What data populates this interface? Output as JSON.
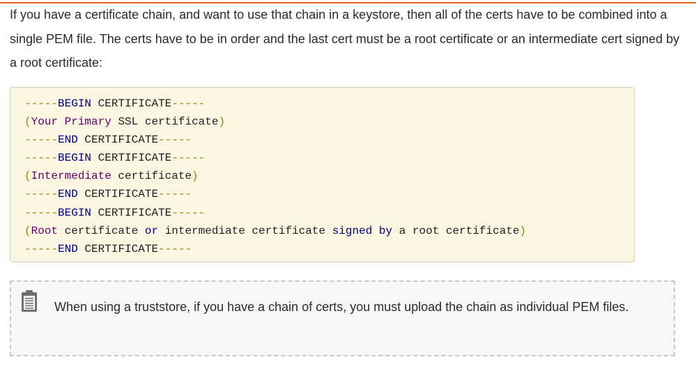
{
  "theme": {
    "accent": "#e8641b",
    "code_bg": "#fbf6e2",
    "note_bg": "#f7f7f7",
    "icon_color": "#6f6f6f",
    "token_colors": {
      "punct": "#9a8000",
      "keyword": "#000088",
      "type": "#660066",
      "plain": "#1f1f1f",
      "string": "#008800"
    }
  },
  "document": {
    "intro_paragraph": "If you have a certificate chain, and want to use that chain in a keystore, then all of the certs have to be combined into a single PEM file. The certs have to be in order and the last cert must be a root certificate or an intermediate cert signed by a root certificate:"
  },
  "code_block": {
    "lines": [
      [
        {
          "t": "-----",
          "c": "punct"
        },
        {
          "t": "BEGIN",
          "c": "keyword"
        },
        {
          "t": " CERTIFICATE",
          "c": "plain"
        },
        {
          "t": "-----",
          "c": "punct"
        }
      ],
      [
        {
          "t": "(",
          "c": "punct"
        },
        {
          "t": "Your",
          "c": "type"
        },
        {
          "t": " ",
          "c": "plain"
        },
        {
          "t": "Primary",
          "c": "type"
        },
        {
          "t": " SSL certificate",
          "c": "plain"
        },
        {
          "t": ")",
          "c": "punct"
        }
      ],
      [
        {
          "t": "-----",
          "c": "punct"
        },
        {
          "t": "END",
          "c": "keyword"
        },
        {
          "t": " CERTIFICATE",
          "c": "plain"
        },
        {
          "t": "-----",
          "c": "punct"
        }
      ],
      [
        {
          "t": "-----",
          "c": "punct"
        },
        {
          "t": "BEGIN",
          "c": "keyword"
        },
        {
          "t": " CERTIFICATE",
          "c": "plain"
        },
        {
          "t": "-----",
          "c": "punct"
        }
      ],
      [
        {
          "t": "(",
          "c": "punct"
        },
        {
          "t": "Intermediate",
          "c": "type"
        },
        {
          "t": " certificate",
          "c": "plain"
        },
        {
          "t": ")",
          "c": "punct"
        }
      ],
      [
        {
          "t": "-----",
          "c": "punct"
        },
        {
          "t": "END",
          "c": "keyword"
        },
        {
          "t": " CERTIFICATE",
          "c": "plain"
        },
        {
          "t": "-----",
          "c": "punct"
        }
      ],
      [
        {
          "t": "-----",
          "c": "punct"
        },
        {
          "t": "BEGIN",
          "c": "keyword"
        },
        {
          "t": " CERTIFICATE",
          "c": "plain"
        },
        {
          "t": "-----",
          "c": "punct"
        }
      ],
      [
        {
          "t": "(",
          "c": "punct"
        },
        {
          "t": "Root",
          "c": "type"
        },
        {
          "t": " certificate ",
          "c": "plain"
        },
        {
          "t": "or",
          "c": "keyword"
        },
        {
          "t": " intermediate certificate ",
          "c": "plain"
        },
        {
          "t": "signed",
          "c": "keyword"
        },
        {
          "t": " ",
          "c": "plain"
        },
        {
          "t": "by",
          "c": "keyword"
        },
        {
          "t": " a root certificate",
          "c": "plain"
        },
        {
          "t": ")",
          "c": "punct"
        }
      ],
      [
        {
          "t": "-----",
          "c": "punct"
        },
        {
          "t": "END",
          "c": "keyword"
        },
        {
          "t": " CERTIFICATE",
          "c": "plain"
        },
        {
          "t": "-----",
          "c": "punct"
        }
      ]
    ]
  },
  "note": {
    "icon": "clipboard-note-icon",
    "text": "When using a truststore, if you have a chain of certs, you must upload the chain as individual PEM files."
  }
}
